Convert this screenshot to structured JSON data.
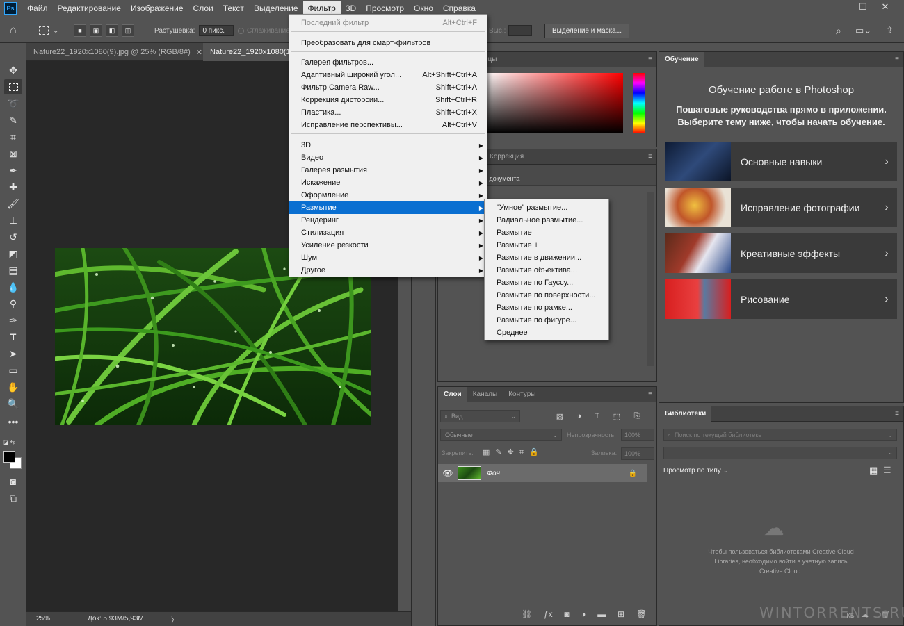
{
  "app": {
    "logo": "Ps"
  },
  "menu": [
    "Файл",
    "Редактирование",
    "Изображение",
    "Слои",
    "Текст",
    "Выделение",
    "Фильтр",
    "3D",
    "Просмотр",
    "Окно",
    "Справка"
  ],
  "window_controls": {
    "minimize": "—",
    "maximize": "☐",
    "close": "✕"
  },
  "options_bar": {
    "feather_label": "Растушевка:",
    "feather_value": "0 пикс.",
    "antialias_label": "Сглаживание",
    "height_label": "Выс.:",
    "select_mask_button": "Выделение и маска..."
  },
  "document_tabs": [
    {
      "label": "Nature22_1920x1080(9).jpg @ 25% (RGB/8#)",
      "close": "✕"
    },
    {
      "label": "Nature22_1920x1080(1"
    }
  ],
  "status": {
    "zoom": "25%",
    "doc": "Док: 5,93M/5,93M",
    "arrow": "〉"
  },
  "filter_menu": {
    "items": [
      {
        "label": "Последний фильтр",
        "shortcut": "Alt+Ctrl+F",
        "disabled": true
      },
      {
        "label": "Преобразовать для смарт-фильтров"
      },
      {
        "label": "Галерея фильтров..."
      },
      {
        "label": "Адаптивный широкий угол...",
        "shortcut": "Alt+Shift+Ctrl+A"
      },
      {
        "label": "Фильтр Camera Raw...",
        "shortcut": "Shift+Ctrl+A"
      },
      {
        "label": "Коррекция дисторсии...",
        "shortcut": "Shift+Ctrl+R"
      },
      {
        "label": "Пластика...",
        "shortcut": "Shift+Ctrl+X"
      },
      {
        "label": "Исправление перспективы...",
        "shortcut": "Alt+Ctrl+V"
      },
      {
        "label": "3D"
      },
      {
        "label": "Видео"
      },
      {
        "label": "Галерея размытия"
      },
      {
        "label": "Искажение"
      },
      {
        "label": "Оформление"
      },
      {
        "label": "Размытие"
      },
      {
        "label": "Рендеринг"
      },
      {
        "label": "Стилизация"
      },
      {
        "label": "Усиление резкости"
      },
      {
        "label": "Шум"
      },
      {
        "label": "Другое"
      }
    ],
    "submenu_arrow": "▶"
  },
  "blur_submenu": {
    "items": [
      "\"Умное\" размытие...",
      "Радиальное размытие...",
      "Размытие",
      "Размытие +",
      "Размытие в движении...",
      "Размытие объектива...",
      "Размытие по Гауссу...",
      "Размытие по поверхности...",
      "Размытие по рамке...",
      "Размытие по фигуре...",
      "Среднее"
    ]
  },
  "color_panel": {
    "tab_partial": "ецы"
  },
  "adjust_panel": {
    "tab": "Коррекция",
    "body_partial": "а документа"
  },
  "layers_panel": {
    "tabs": [
      "Слои",
      "Каналы",
      "Контуры"
    ],
    "search_placeholder": "Вид",
    "blend_mode": "Обычные",
    "opacity_label": "Непрозрачность:",
    "opacity_value": "100%",
    "lock_label": "Закрепить:",
    "fill_label": "Заливка:",
    "fill_value": "100%",
    "layer_name": "Фон"
  },
  "learn_panel": {
    "tab": "Обучение",
    "title": "Обучение работе в Photoshop",
    "subtitle": "Пошаговые руководства прямо в приложении. Выберите тему ниже, чтобы начать обучение.",
    "cards": [
      "Основные навыки",
      "Исправление фотографии",
      "Креативные эффекты",
      "Рисование"
    ]
  },
  "libraries_panel": {
    "tab": "Библиотеки",
    "search_placeholder": "Поиск по текущей библиотеке",
    "view_by": "Просмотр по типу",
    "message": "Чтобы пользоваться библиотеками Creative Cloud Libraries, необходимо войти в учетную запись Creative Cloud.",
    "size": "– КБ"
  },
  "watermark": "WINTORRENTS.RU"
}
